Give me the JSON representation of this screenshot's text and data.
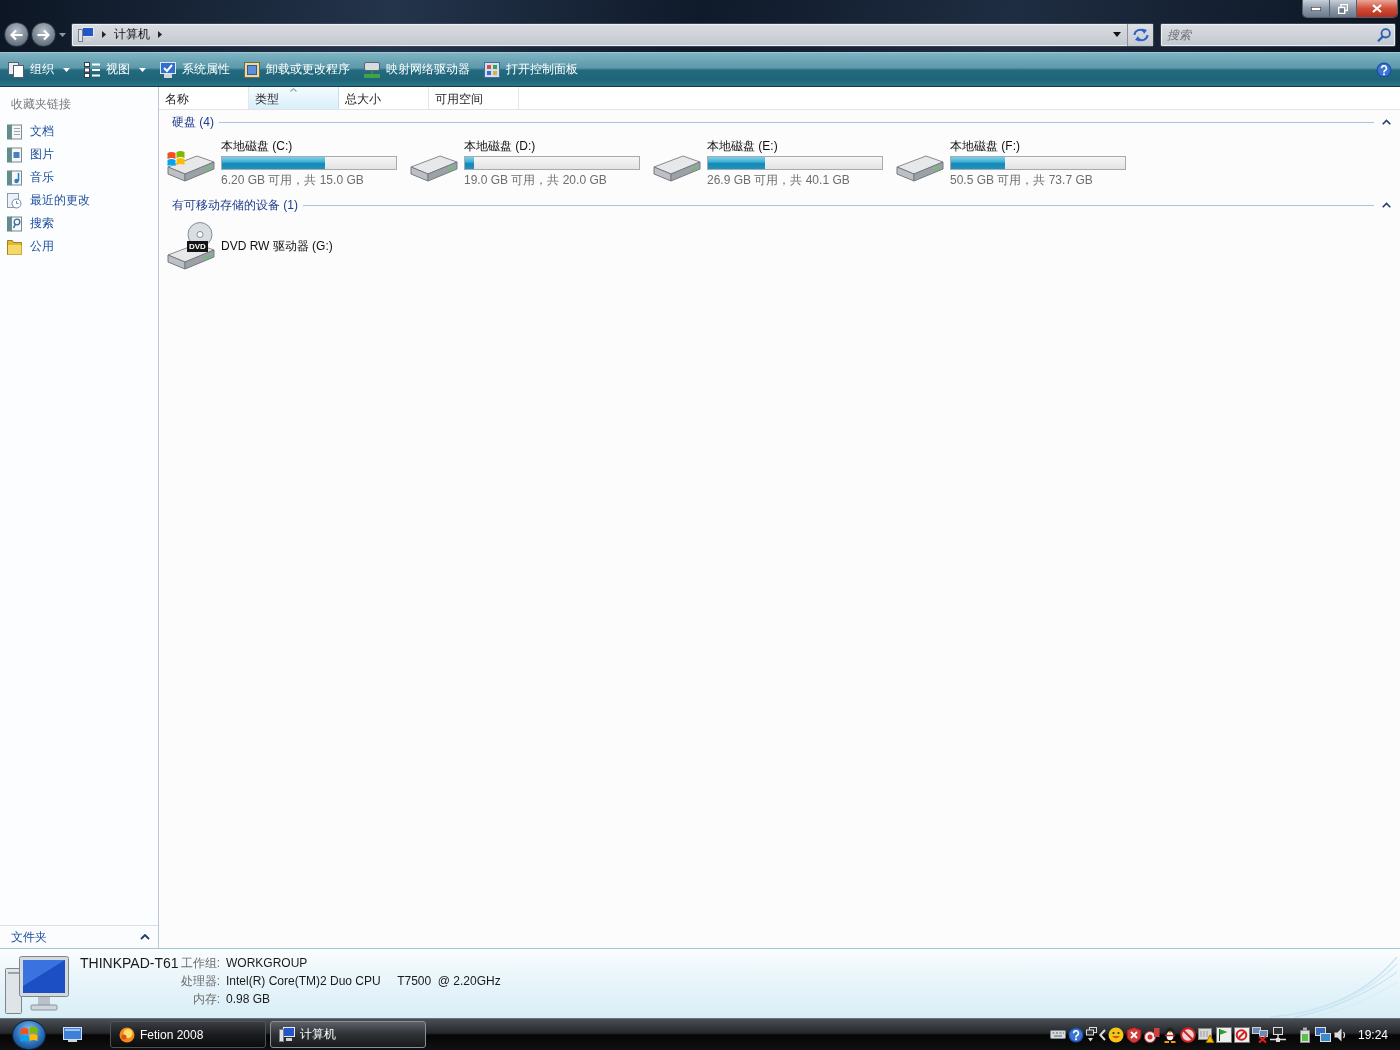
{
  "address_bar": {
    "path": [
      {
        "label": "计算机"
      }
    ],
    "search_placeholder": "搜索"
  },
  "toolbar": {
    "items": [
      {
        "label": "组织",
        "kind": "menu"
      },
      {
        "label": "视图",
        "kind": "menu"
      },
      {
        "label": "系统属性",
        "kind": "action"
      },
      {
        "label": "卸载或更改程序",
        "kind": "action"
      },
      {
        "label": "映射网络驱动器",
        "kind": "action"
      },
      {
        "label": "打开控制面板",
        "kind": "action"
      }
    ]
  },
  "sidebar": {
    "heading": "收藏夹链接",
    "items": [
      {
        "label": "文档"
      },
      {
        "label": "图片"
      },
      {
        "label": "音乐"
      },
      {
        "label": "最近的更改"
      },
      {
        "label": "搜索"
      },
      {
        "label": "公用"
      }
    ],
    "folders": {
      "label": "文件夹",
      "expanded": false
    }
  },
  "columns": [
    {
      "label": "名称",
      "sorted": false
    },
    {
      "label": "类型",
      "sorted": true
    },
    {
      "label": "总大小",
      "sorted": false
    },
    {
      "label": "可用空间",
      "sorted": false
    }
  ],
  "groups": [
    {
      "title": "硬盘 (4)",
      "expanded": true,
      "items": [
        {
          "kind": "disk",
          "name": "本地磁盘 (C:)",
          "system": true,
          "level": 0.59,
          "detail": "6.20 GB 可用，共 15.0 GB"
        },
        {
          "kind": "disk",
          "name": "本地磁盘 (D:)",
          "system": false,
          "level": 0.05,
          "detail": "19.0 GB 可用，共 20.0 GB"
        },
        {
          "kind": "disk",
          "name": "本地磁盘 (E:)",
          "system": false,
          "level": 0.33,
          "detail": "26.9 GB 可用，共 40.1 GB"
        },
        {
          "kind": "disk",
          "name": "本地磁盘 (F:)",
          "system": false,
          "level": 0.31,
          "detail": "50.5 GB 可用，共 73.7 GB"
        }
      ]
    },
    {
      "title": "有可移动存储的设备 (1)",
      "expanded": true,
      "items": [
        {
          "kind": "dvd",
          "name": "DVD RW 驱动器 (G:)",
          "badge": "DVD"
        }
      ]
    }
  ],
  "details": {
    "name": "THINKPAD-T61",
    "fields": [
      {
        "label": "工作组:",
        "value": "WORKGROUP"
      },
      {
        "label": "处理器:",
        "value": "Intel(R) Core(TM)2 Duo CPU     T7500  @ 2.20GHz"
      },
      {
        "label": "内存:",
        "value": "0.98 GB"
      }
    ]
  },
  "taskbar": {
    "tasks": [
      {
        "label": "Fetion 2008",
        "selected": false
      },
      {
        "label": "计算机",
        "selected": true
      }
    ],
    "clock": "19:24"
  }
}
